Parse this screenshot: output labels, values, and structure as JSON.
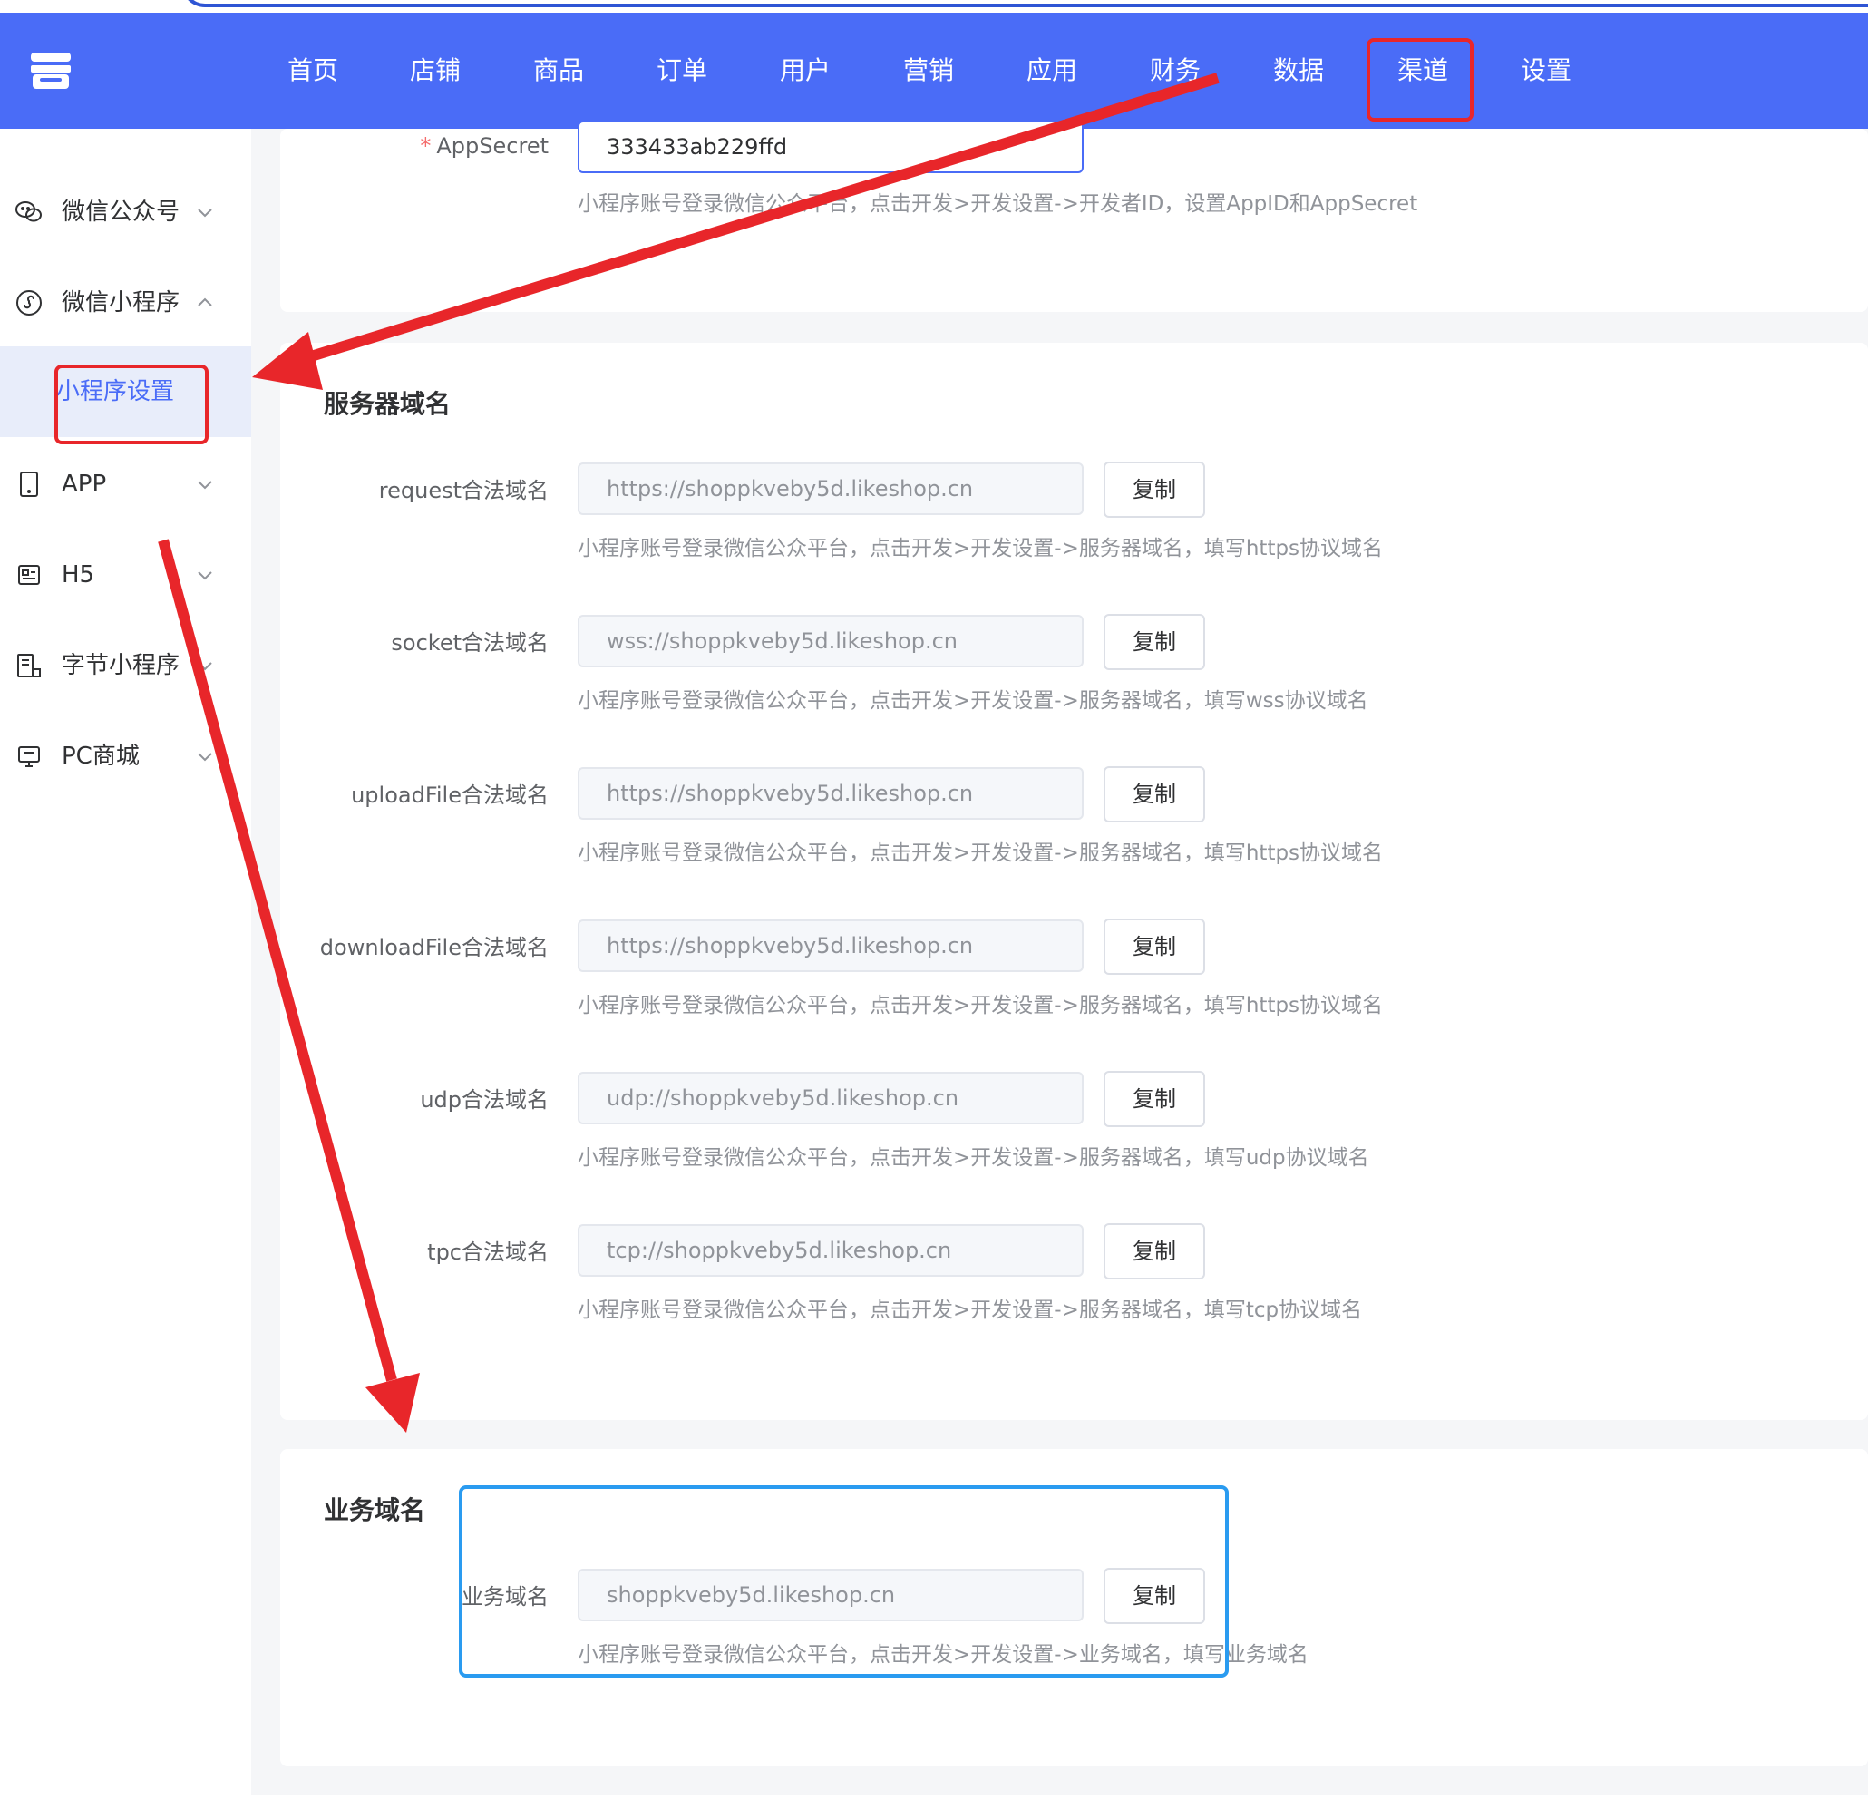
{
  "nav": {
    "items": [
      {
        "label": "首页"
      },
      {
        "label": "店铺"
      },
      {
        "label": "商品"
      },
      {
        "label": "订单"
      },
      {
        "label": "用户"
      },
      {
        "label": "营销"
      },
      {
        "label": "应用"
      },
      {
        "label": "财务"
      },
      {
        "label": "数据"
      },
      {
        "label": "渠道"
      },
      {
        "label": "设置"
      }
    ],
    "active": "渠道"
  },
  "sidebar": {
    "items": [
      {
        "label": "微信公众号",
        "icon": "wechat-icon"
      },
      {
        "label": "微信小程序",
        "icon": "miniprogram-icon"
      },
      {
        "label": "APP",
        "icon": "tablet-icon"
      },
      {
        "label": "H5",
        "icon": "h5-icon"
      },
      {
        "label": "字节小程序",
        "icon": "bytedance-icon"
      },
      {
        "label": "PC商城",
        "icon": "monitor-icon"
      }
    ],
    "sub_item": "小程序设置"
  },
  "appsecret": {
    "label": "AppSecret",
    "value": "333433ab229ffd",
    "hint": "小程序账号登录微信公众平台，点击开发>开发设置->开发者ID，设置AppID和AppSecret"
  },
  "server_domains": {
    "title": "服务器域名",
    "rows": [
      {
        "label": "request合法域名",
        "value": "https://shoppkveby5d.likeshop.cn",
        "hint": "小程序账号登录微信公众平台，点击开发>开发设置->服务器域名，填写https协议域名"
      },
      {
        "label": "socket合法域名",
        "value": "wss://shoppkveby5d.likeshop.cn",
        "hint": "小程序账号登录微信公众平台，点击开发>开发设置->服务器域名，填写wss协议域名"
      },
      {
        "label": "uploadFile合法域名",
        "value": "https://shoppkveby5d.likeshop.cn",
        "hint": "小程序账号登录微信公众平台，点击开发>开发设置->服务器域名，填写https协议域名"
      },
      {
        "label": "downloadFile合法域名",
        "value": "https://shoppkveby5d.likeshop.cn",
        "hint": "小程序账号登录微信公众平台，点击开发>开发设置->服务器域名，填写https协议域名"
      },
      {
        "label": "udp合法域名",
        "value": "udp://shoppkveby5d.likeshop.cn",
        "hint": "小程序账号登录微信公众平台，点击开发>开发设置->服务器域名，填写udp协议域名"
      },
      {
        "label": "tpc合法域名",
        "value": "tcp://shoppkveby5d.likeshop.cn",
        "hint": "小程序账号登录微信公众平台，点击开发>开发设置->服务器域名，填写tcp协议域名"
      }
    ]
  },
  "business_domain": {
    "title": "业务域名",
    "label": "业务域名",
    "value": "shoppkveby5d.likeshop.cn",
    "hint": "小程序账号登录微信公众平台，点击开发>开发设置->业务域名，填写业务域名"
  },
  "copy_label": "复制",
  "colors": {
    "header": "#4a6cf7",
    "annotation_red": "#e8262a",
    "annotation_blue": "#2a9bf0"
  }
}
